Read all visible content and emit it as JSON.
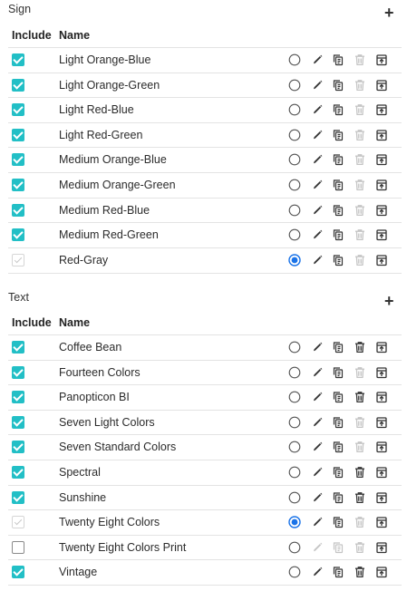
{
  "sections": [
    {
      "title": "Sign",
      "add_label": "+",
      "headers": {
        "include": "Include",
        "name": "Name"
      },
      "rows": [
        {
          "name": "Light Orange-Blue",
          "include": "on",
          "selected": false,
          "edit": true,
          "del": false
        },
        {
          "name": "Light Orange-Green",
          "include": "on",
          "selected": false,
          "edit": true,
          "del": false
        },
        {
          "name": "Light Red-Blue",
          "include": "on",
          "selected": false,
          "edit": true,
          "del": false
        },
        {
          "name": "Light Red-Green",
          "include": "on",
          "selected": false,
          "edit": true,
          "del": false
        },
        {
          "name": "Medium Orange-Blue",
          "include": "on",
          "selected": false,
          "edit": true,
          "del": false
        },
        {
          "name": "Medium Orange-Green",
          "include": "on",
          "selected": false,
          "edit": true,
          "del": false
        },
        {
          "name": "Medium Red-Blue",
          "include": "on",
          "selected": false,
          "edit": true,
          "del": false
        },
        {
          "name": "Medium Red-Green",
          "include": "on",
          "selected": false,
          "edit": true,
          "del": false
        },
        {
          "name": "Red-Gray",
          "include": "disabled",
          "selected": true,
          "edit": true,
          "del": false
        }
      ]
    },
    {
      "title": "Text",
      "add_label": "+",
      "headers": {
        "include": "Include",
        "name": "Name"
      },
      "rows": [
        {
          "name": "Coffee Bean",
          "include": "on",
          "selected": false,
          "edit": true,
          "del": true
        },
        {
          "name": "Fourteen Colors",
          "include": "on",
          "selected": false,
          "edit": true,
          "del": false
        },
        {
          "name": "Panopticon BI",
          "include": "on",
          "selected": false,
          "edit": true,
          "del": true
        },
        {
          "name": "Seven Light Colors",
          "include": "on",
          "selected": false,
          "edit": true,
          "del": false
        },
        {
          "name": "Seven Standard Colors",
          "include": "on",
          "selected": false,
          "edit": true,
          "del": false
        },
        {
          "name": "Spectral",
          "include": "on",
          "selected": false,
          "edit": true,
          "del": true
        },
        {
          "name": "Sunshine",
          "include": "on",
          "selected": false,
          "edit": true,
          "del": true
        },
        {
          "name": "Twenty Eight Colors",
          "include": "disabled",
          "selected": true,
          "edit": true,
          "del": false
        },
        {
          "name": "Twenty Eight Colors Print",
          "include": "off",
          "selected": false,
          "edit": false,
          "del": false
        },
        {
          "name": "Vintage",
          "include": "on",
          "selected": false,
          "edit": true,
          "del": true
        }
      ]
    }
  ],
  "colors": {
    "accent": "#22bfc6",
    "radio_selected": "#1a73e8",
    "icon": "#333333",
    "icon_disabled": "#c4c4c4"
  },
  "icons": {
    "radio": "radio-icon",
    "edit": "pencil-icon",
    "copy": "copy-icon",
    "delete": "trash-icon",
    "export": "export-icon"
  }
}
